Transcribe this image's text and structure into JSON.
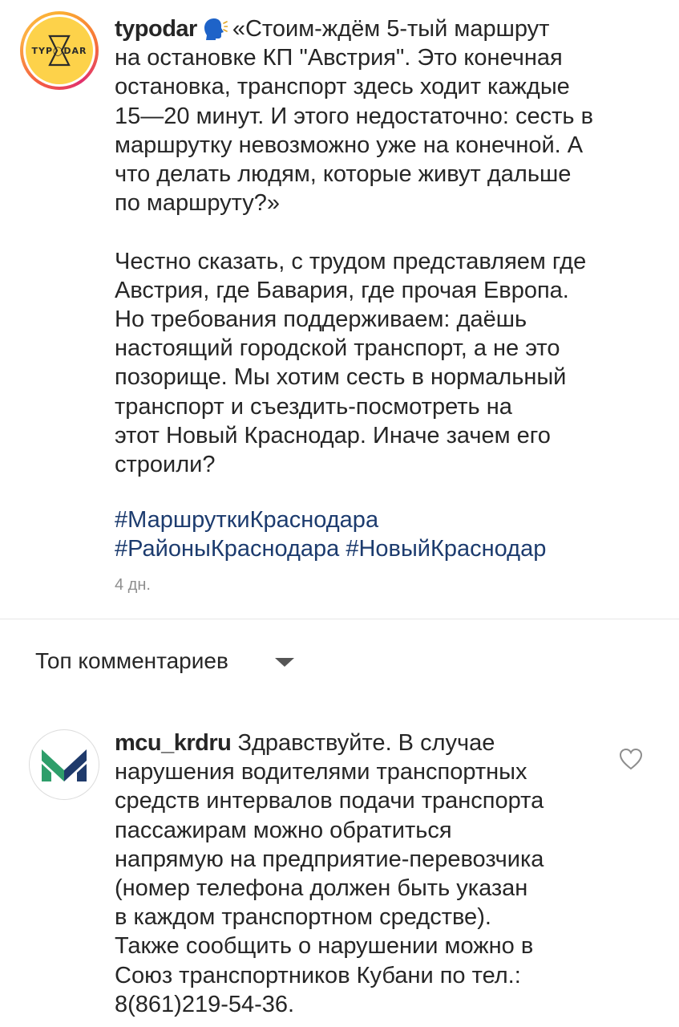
{
  "post": {
    "username": "typodar",
    "avatar_logo_text": "TYP◯DAR",
    "caption": "«Стоим-ждём 5-тый маршрут\nна остановке КП \"Австрия\". Это конечная\nостановка, транспорт здесь ходит каждые\n15—20 минут. И этого недостаточно: сесть в\nмаршрутку невозможно уже на конечной. А\nчто делать людям, которые живут дальше\nпо маршруту?»\n\nЧестно сказать, с трудом представляем где\nАвстрия, где Бавария, где прочая Европа.\nНо требования поддерживаем: даёшь\nнастоящий городской транспорт, а не это\nпозорище. Мы хотим сесть в нормальный\nтранспорт и съездить-посмотреть на\nэтот Новый Краснодар. Иначе зачем его\nстроили?",
    "hashtags": [
      "#МаршруткиКраснодара",
      "#РайоныКраснодара",
      "#НовыйКраснодар"
    ],
    "timestamp": "4 дн."
  },
  "comments_sort": {
    "label": "Топ комментариев"
  },
  "comment": {
    "username": "mcu_krdru",
    "text": "Здравствуйте. В случае\nнарушения водителями транспортных\nсредств интервалов подачи транспорта\nпассажирам можно обратиться\nнапрямую на предприятие-перевозчика\n(номер телефона должен быть указан\nв каждом транспортном средстве).\nТакже сообщить о нарушении можно в\nСоюз транспортников Кубани по тел.:\n8(861)219-54-36."
  },
  "colors": {
    "hashtag": "#1c3b6e",
    "muted": "#8e8e8e",
    "avatar_yellow": "#fdd24a",
    "logo_green": "#2e9e6a",
    "logo_navy": "#1f3a6b"
  },
  "icons": {
    "speaking_head": "speaking-head-icon",
    "sort_caret": "chevron-down-icon",
    "like": "heart-icon"
  }
}
